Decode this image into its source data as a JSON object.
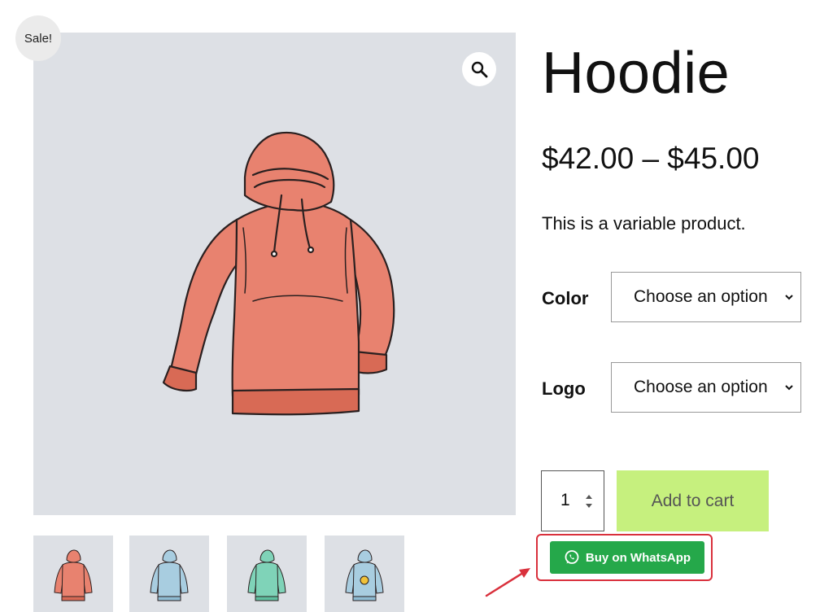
{
  "product": {
    "title": "Hoodie",
    "price": "$42.00 – $45.00",
    "description": "This is a variable product.",
    "sale_badge": "Sale!"
  },
  "variations": [
    {
      "label": "Color",
      "selected": "Choose an option"
    },
    {
      "label": "Logo",
      "selected": "Choose an option"
    }
  ],
  "cart": {
    "quantity": "1",
    "add_to_cart_label": "Add to cart"
  },
  "whatsapp": {
    "label": "Buy on WhatsApp",
    "color": "#25a84a",
    "highlight_color": "#d9303c"
  },
  "gallery": {
    "thumbnails": [
      {
        "color": "#e8826f",
        "icon": "hoodie-red"
      },
      {
        "color": "#a8cde0",
        "icon": "hoodie-blue"
      },
      {
        "color": "#7fd3b8",
        "icon": "hoodie-green"
      },
      {
        "color": "#a8cde0",
        "icon": "hoodie-blue-logo"
      }
    ]
  },
  "icons": {
    "zoom": "search-icon",
    "whatsapp": "whatsapp-icon",
    "select_arrow": "chevron-down-icon",
    "quantity_spinner": "spinner-icon",
    "annotation": "red-arrow"
  },
  "colors": {
    "image_background": "#dde0e5",
    "add_to_cart_bg": "#c6f07e",
    "hoodie_main": "#e8826f"
  }
}
